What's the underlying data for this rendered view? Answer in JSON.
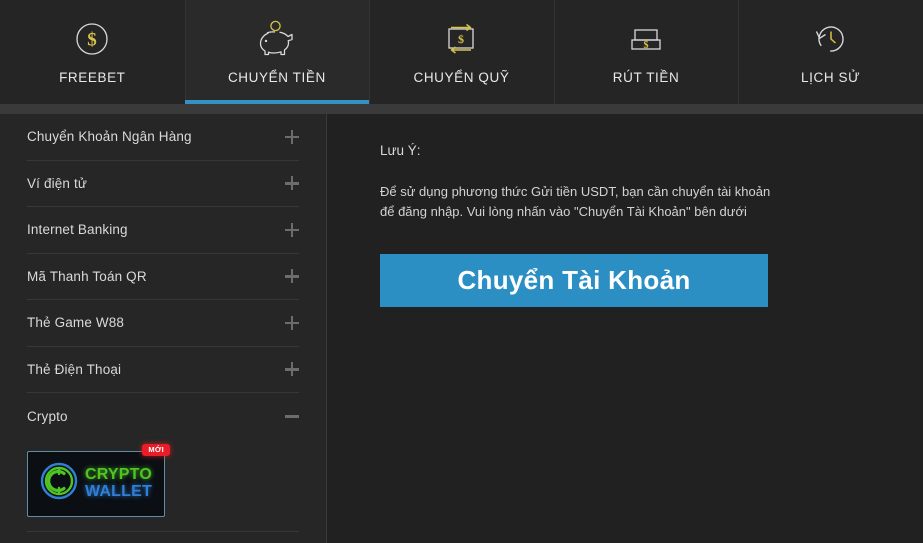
{
  "tabs": [
    {
      "id": "freebet",
      "label": "FREEBET",
      "icon": "dollar-circle-icon",
      "active": false
    },
    {
      "id": "chuyen-tien",
      "label": "CHUYỂN TIỀN",
      "icon": "piggy-bank-icon",
      "active": true
    },
    {
      "id": "chuyen-quy",
      "label": "CHUYỂN QUỸ",
      "icon": "transfer-funds-icon",
      "active": false
    },
    {
      "id": "rut-tien",
      "label": "RÚT TIỀN",
      "icon": "atm-cash-icon",
      "active": false
    },
    {
      "id": "lich-su",
      "label": "LỊCH SỬ",
      "icon": "history-clock-icon",
      "active": false
    }
  ],
  "sidebar": {
    "items": [
      {
        "label": "Chuyển Khoản Ngân Hàng",
        "state": "collapsed"
      },
      {
        "label": "Ví điện tử",
        "state": "collapsed"
      },
      {
        "label": "Internet Banking",
        "state": "collapsed"
      },
      {
        "label": "Mã Thanh Toán QR",
        "state": "collapsed"
      },
      {
        "label": "Thẻ Game W88",
        "state": "collapsed"
      },
      {
        "label": "Thẻ Điện Thoại",
        "state": "collapsed"
      },
      {
        "label": "Crypto",
        "state": "expanded"
      }
    ],
    "crypto_wallet": {
      "badge": "MỚI",
      "line1": "CRYPTO",
      "line2": "WALLET"
    }
  },
  "content": {
    "note_title": "Lưu Ý:",
    "note_body": "Để sử dụng phương thức Gửi tiền USDT, bạn cần chuyển tài khoản để đăng nhập. Vui lòng nhấn vào \"Chuyển Tài Khoản\" bên dưới",
    "cta_label": "Chuyển Tài Khoản"
  },
  "colors": {
    "accent_blue": "#3591c4",
    "button_blue": "#2b8fc4",
    "icon_gold": "#d8c348",
    "badge_red": "#e81d28",
    "logo_green": "#4fc524",
    "logo_blue": "#2f7fd6",
    "page_bg": "#212121",
    "panel_bg": "#262626"
  }
}
